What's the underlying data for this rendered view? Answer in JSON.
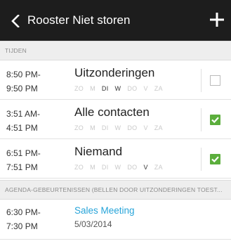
{
  "header": {
    "title": "Rooster Niet storen",
    "back_icon": "chevron-left-icon",
    "add_icon": "plus-icon"
  },
  "sections": {
    "times_label": "TIJDEN",
    "agenda_label": "AGENDA-GEBEURTENISSEN (BELLEN DOOR UITZONDERINGEN TOEST..."
  },
  "rows": [
    {
      "start": "8:50 PM-",
      "end": "9:50 PM",
      "name": "Uitzonderingen",
      "days": [
        {
          "label": "ZO",
          "on": false
        },
        {
          "label": "M",
          "on": false
        },
        {
          "label": "DI",
          "on": true
        },
        {
          "label": "W",
          "on": true
        },
        {
          "label": "DO",
          "on": false
        },
        {
          "label": "V",
          "on": false
        },
        {
          "label": "ZA",
          "on": false
        }
      ],
      "checked": false
    },
    {
      "start": "3:51 AM-",
      "end": "4:51 PM",
      "name": "Alle contacten",
      "days": [
        {
          "label": "ZO",
          "on": false
        },
        {
          "label": "M",
          "on": false
        },
        {
          "label": "DI",
          "on": false
        },
        {
          "label": "W",
          "on": false
        },
        {
          "label": "DO",
          "on": false
        },
        {
          "label": "V",
          "on": false
        },
        {
          "label": "ZA",
          "on": false
        }
      ],
      "checked": true
    },
    {
      "start": "6:51 PM-",
      "end": "7:51 PM",
      "name": "Niemand",
      "days": [
        {
          "label": "ZO",
          "on": false
        },
        {
          "label": "M",
          "on": false
        },
        {
          "label": "DI",
          "on": false
        },
        {
          "label": "W",
          "on": false
        },
        {
          "label": "DO",
          "on": false
        },
        {
          "label": "V",
          "on": true
        },
        {
          "label": "ZA",
          "on": false
        }
      ],
      "checked": true
    }
  ],
  "events": [
    {
      "start": "6:30 PM-",
      "end": "7:30 PM",
      "title": "Sales Meeting",
      "date": "5/03/2014"
    }
  ],
  "colors": {
    "topbar": "#1d1d1d",
    "accent_blue": "#27a4d9",
    "check_green": "#5bae3c"
  }
}
